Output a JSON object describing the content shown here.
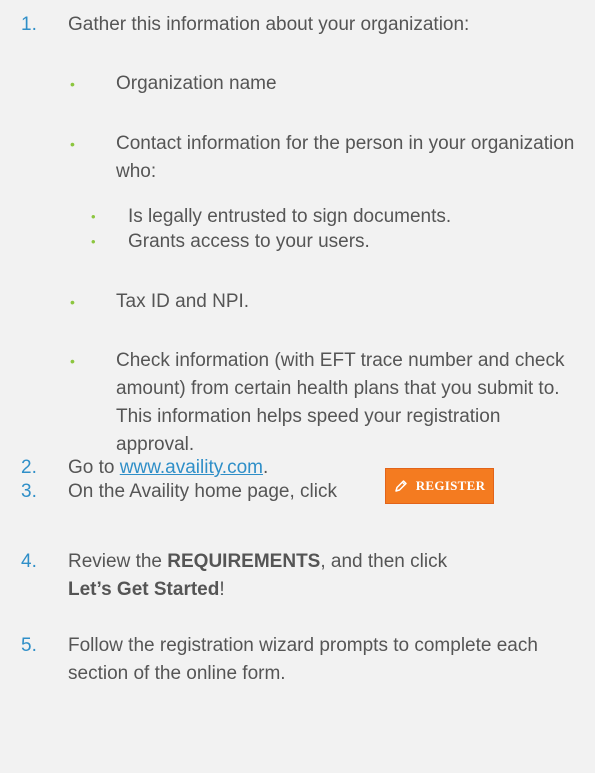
{
  "steps": [
    {
      "number": "1.",
      "text": "Gather this information about your organization:",
      "bullets": [
        {
          "text": "Organization name"
        },
        {
          "text": "Contact information for the person in your organization who:",
          "sub_bullets": [
            "Is legally entrusted to sign documents.",
            "Grants access to your users."
          ]
        },
        {
          "text": "Tax ID and NPI."
        },
        {
          "text": "Check information (with EFT trace number and check amount) from certain health plans that you submit to. This information helps speed your registration approval."
        }
      ]
    },
    {
      "number": "2.",
      "text_before": "Go to ",
      "link_text": "www.availity.com",
      "text_after": "."
    },
    {
      "number": "3.",
      "text": "On the Availity home page, click",
      "button_label": "REGISTER",
      "button_icon": "pencil-icon"
    },
    {
      "number": "4.",
      "text_before": "Review the ",
      "bold_1": "REQUIREMENTS",
      "text_middle": ", and then click",
      "bold_2": "Let’s Get Started",
      "text_after": "!"
    },
    {
      "number": "5.",
      "text": "Follow the registration wizard prompts to complete each section of the online form."
    }
  ],
  "bullet_glyph": "•",
  "colors": {
    "background": "#f2f2f2",
    "number": "#2f8fc8",
    "bullet": "#8cc63f",
    "text": "#555555",
    "link": "#2f8fc8",
    "button": "#f47b20"
  }
}
